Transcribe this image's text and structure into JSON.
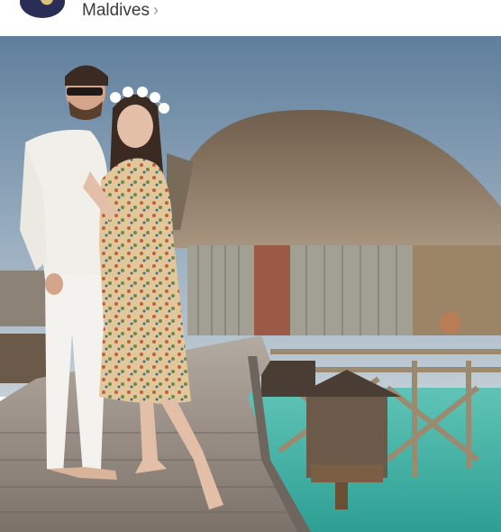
{
  "post": {
    "location": "Maldives",
    "location_chevron": "›"
  },
  "photo": {
    "subject": "couple-on-overwater-boardwalk"
  },
  "colors": {
    "sky": "#7d96ab",
    "water": "#3fb5a8",
    "thatch": "#8a7660",
    "deck": "#8b7e72"
  }
}
